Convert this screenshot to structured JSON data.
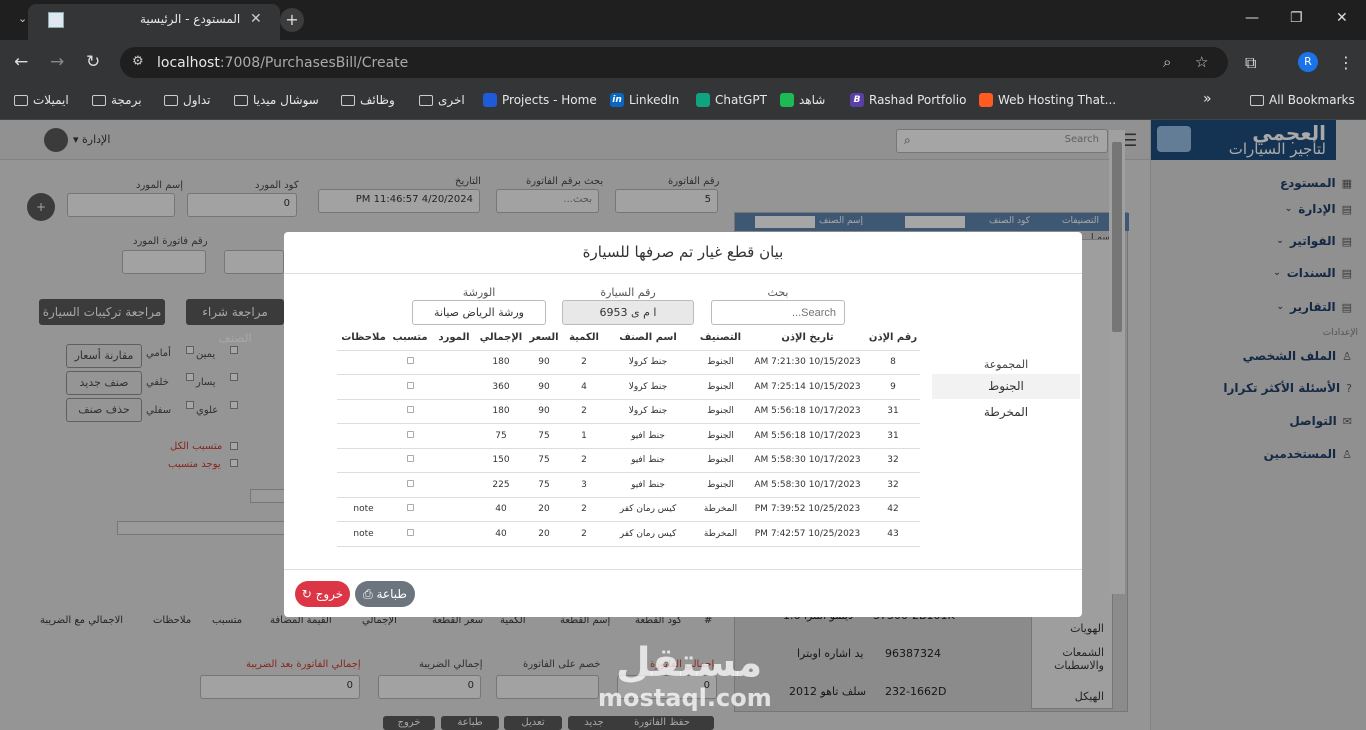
{
  "browser": {
    "tab_title": "المستودع - الرئيسية",
    "tab_close": "✕",
    "new_tab": "+",
    "url_host": "localhost",
    "url_path": ":7008/PurchasesBill/Create",
    "profile_initial": "R",
    "window": {
      "minimize": "—",
      "restore": "❐",
      "close": "✕"
    }
  },
  "bookmarks": [
    {
      "label": "ايميلات",
      "type": "folder"
    },
    {
      "label": "برمجة",
      "type": "folder"
    },
    {
      "label": "تداول",
      "type": "folder"
    },
    {
      "label": "سوشال ميديا",
      "type": "folder"
    },
    {
      "label": "وظائف",
      "type": "folder"
    },
    {
      "label": "اخرى",
      "type": "folder"
    },
    {
      "label": "Projects - Home",
      "type": "site",
      "color": "#1e5bd8"
    },
    {
      "label": "LinkedIn",
      "type": "site",
      "color": "#0a66c2"
    },
    {
      "label": "ChatGPT",
      "type": "site",
      "color": "#10a37f"
    },
    {
      "label": "شاهد",
      "type": "site",
      "color": "#1db954"
    },
    {
      "label": "Rashad Portfolio",
      "type": "site",
      "color": "#5b3fa8"
    },
    {
      "label": "Web Hosting That...",
      "type": "site",
      "color": "#ff5a1f"
    }
  ],
  "bookmarks_more": "»",
  "all_bookmarks": "All Bookmarks",
  "app": {
    "user_label": "▾ الإدارة",
    "search_placeholder": "Search",
    "logo_line1": "العجمي",
    "logo_line2": "لتأجير السيارات",
    "sidebar": [
      {
        "label": "المستودع",
        "chevron": ""
      },
      {
        "label": "الإدارة",
        "chevron": "⌄"
      },
      {
        "label": "الفواتير",
        "chevron": "⌄"
      },
      {
        "label": "السندات",
        "chevron": "⌄"
      },
      {
        "label": "التقارير",
        "chevron": "⌄"
      },
      {
        "label": "الملف الشخصي",
        "chevron": ""
      },
      {
        "label": "الأسئلة الأكثر تكرارا",
        "chevron": ""
      },
      {
        "label": "التواصل",
        "chevron": ""
      },
      {
        "label": "المستخدمين",
        "chevron": ""
      }
    ],
    "sidebar_section": "الإعدادات"
  },
  "form": {
    "invoice_no_label": "رقم الفاتورة",
    "invoice_no": "5",
    "search_invoice_label": "بحث برقم الفاتورة",
    "search_invoice_ph": "بحث...",
    "date_label": "التاريخ",
    "date_value": "4/20/2024 11:46:57 PM",
    "supplier_code_label": "كود المورد",
    "supplier_code": "0",
    "supplier_name_label": "إسم المورد",
    "supplier_invoice_label": "رقم فاتورة المورد",
    "btn_review_purchase": "مراجعة شراء الصنف",
    "btn_review_install": "مراجعة تركيبات السيارة",
    "btn_compare_prices": "مقارنة أسعار",
    "btn_new_item": "صنف جديد",
    "btn_delete_item": "حذف صنف",
    "checks": [
      "يمين",
      "أمامي",
      "يسار",
      "خلفي",
      "علوي",
      "سفلي"
    ],
    "check_all_cause": "متسبب الكل",
    "check_has_cause": "يوجد متسبب",
    "grid_headers": [
      "#",
      "كود القطعة",
      "إسم القطعة",
      "الكمية",
      "سعر القطعة",
      "الإجمالي",
      "القيمة المضافة",
      "متسبب",
      "ملاحظات",
      "الاجمالي مع الضريبة"
    ],
    "total_invoice_label": "إجمالي الفاتورة",
    "total_invoice": "0",
    "discount_label": "خصم على الفاتورة",
    "tax_total_label": "إجمالي الضريبة",
    "tax_total": "0",
    "total_after_tax_label": "إجمالي الفاتورة بعد الضريبة",
    "total_after_tax": "0",
    "right_panel_filters": [
      "التصنيفات",
      "كود الصنف",
      "إسم الصنف"
    ],
    "right_panel_extra": "إسم ا",
    "right_panel_rows": [
      {
        "code": "37300-2B101K",
        "name": "دينمو النترا 1.6"
      },
      {
        "code": "96387324",
        "name": "يد اشاره اوبترا"
      },
      {
        "code": "232-1662D",
        "name": "سلف تاهو 2012"
      }
    ],
    "right_panel_cats": [
      "الهويات",
      "الشمعات والاسطبات",
      "الهيكل"
    ],
    "bottom_buttons": [
      "حفظ الفاتورة",
      "جديد",
      "تعديل",
      "طباعة",
      "خروج"
    ]
  },
  "modal": {
    "title": "بيان قطع غيار تم صرفها للسيارة",
    "search_label": "بحث",
    "search_placeholder": "Search...",
    "car_no_label": "رقم السيارة",
    "car_no": "ا م ى 6953",
    "workshop_label": "الورشة",
    "workshop": "ورشة الرياض صيانة",
    "group_title": "المجموعة",
    "groups": [
      "الجنوط",
      "المخرطة"
    ],
    "columns": [
      "رقم الإذن",
      "تاريخ الإذن",
      "التصنيف",
      "اسم الصنف",
      "الكمية",
      "السعر",
      "الإجمالي",
      "المورد",
      "متسبب",
      "ملاحظات"
    ],
    "rows": [
      {
        "no": "8",
        "date": "10/15/2023 7:21:30 AM",
        "cat": "الجنوط",
        "item": "جنط كرولا",
        "qty": "2",
        "price": "90",
        "total": "180",
        "supplier": "",
        "notes": ""
      },
      {
        "no": "9",
        "date": "10/15/2023 7:25:14 AM",
        "cat": "الجنوط",
        "item": "جنط كرولا",
        "qty": "4",
        "price": "90",
        "total": "360",
        "supplier": "",
        "notes": ""
      },
      {
        "no": "31",
        "date": "10/17/2023 5:56:18 AM",
        "cat": "الجنوط",
        "item": "جنط كرولا",
        "qty": "2",
        "price": "90",
        "total": "180",
        "supplier": "",
        "notes": ""
      },
      {
        "no": "31",
        "date": "10/17/2023 5:56:18 AM",
        "cat": "الجنوط",
        "item": "جنط افيو",
        "qty": "1",
        "price": "75",
        "total": "75",
        "supplier": "",
        "notes": ""
      },
      {
        "no": "32",
        "date": "10/17/2023 5:58:30 AM",
        "cat": "الجنوط",
        "item": "جنط افيو",
        "qty": "2",
        "price": "75",
        "total": "150",
        "supplier": "",
        "notes": ""
      },
      {
        "no": "32",
        "date": "10/17/2023 5:58:30 AM",
        "cat": "الجنوط",
        "item": "جنط افيو",
        "qty": "3",
        "price": "75",
        "total": "225",
        "supplier": "",
        "notes": ""
      },
      {
        "no": "42",
        "date": "10/25/2023 7:39:52 PM",
        "cat": "المخرطة",
        "item": "كيس رمان كفر",
        "qty": "2",
        "price": "20",
        "total": "40",
        "supplier": "",
        "notes": "note"
      },
      {
        "no": "43",
        "date": "10/25/2023 7:42:57 PM",
        "cat": "المخرطة",
        "item": "كيس رمان كفر",
        "qty": "2",
        "price": "20",
        "total": "40",
        "supplier": "",
        "notes": "note"
      }
    ],
    "print_label": "طباعة",
    "exit_label": "خروج"
  },
  "watermark": {
    "ar": "مستقل",
    "en": "mostaql.com"
  }
}
